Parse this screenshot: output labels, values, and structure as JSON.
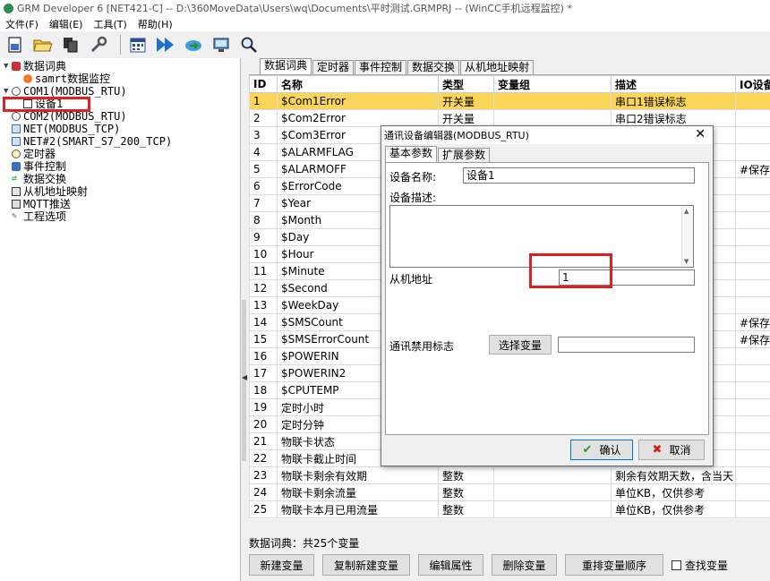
{
  "window": {
    "title": "GRM Developer 6 [NET421-C]  -- D:\\360MoveData\\Users\\wq\\Documents\\平时测试.GRMPRJ -- (WinCC手机远程监控) *"
  },
  "menu": [
    "文件(F)",
    "编辑(E)",
    "工具(T)",
    "帮助(H)"
  ],
  "toolbar_icons": [
    "new-project-icon",
    "open-folder-icon",
    "copy-icon",
    "wrench-icon",
    "calendar-grid-icon",
    "fast-forward-icon",
    "cloud-sync-icon",
    "monitor-icon",
    "search-icon"
  ],
  "tree": {
    "items": [
      {
        "label": "数据词典",
        "icon": "book-icon"
      },
      {
        "label": "samrt数据监控",
        "icon": "tag-icon"
      },
      {
        "label": "COM1(MODBUS_RTU)",
        "icon": "serial-port-icon"
      },
      {
        "label": "设备1",
        "icon": "device-icon"
      },
      {
        "label": "COM2(MODBUS_RTU)",
        "icon": "serial-port-icon"
      },
      {
        "label": "NET(MODBUS_TCP)",
        "icon": "network-icon"
      },
      {
        "label": "NET#2(SMART_S7_200_TCP)",
        "icon": "network-icon"
      },
      {
        "label": "定时器",
        "icon": "clock-icon"
      },
      {
        "label": "事件控制",
        "icon": "event-icon"
      },
      {
        "label": "数据交换",
        "icon": "exchange-icon"
      },
      {
        "label": "从机地址映射",
        "icon": "mapping-icon"
      },
      {
        "label": "MQTT推送",
        "icon": "mqtt-icon"
      },
      {
        "label": "工程选项",
        "icon": "tools-icon"
      }
    ]
  },
  "main_tabs": [
    "数据词典",
    "定时器",
    "事件控制",
    "数据交换",
    "从机地址映射"
  ],
  "grid": {
    "columns": [
      "ID",
      "名称",
      "类型",
      "变量组",
      "描述",
      "IO设备"
    ],
    "rows": [
      [
        "1",
        "$Com1Error",
        "开关量",
        "",
        "串口1错误标志",
        ""
      ],
      [
        "2",
        "$Com2Error",
        "开关量",
        "",
        "串口2错误标志",
        ""
      ],
      [
        "3",
        "$Com3Error",
        "",
        "",
        "",
        ""
      ],
      [
        "4",
        "$ALARMFLAG",
        "",
        "",
        "何报",
        ""
      ],
      [
        "5",
        "$ALARMOFF",
        "",
        "",
        "",
        "#保存位"
      ],
      [
        "6",
        "$ErrorCode",
        "",
        "",
        "",
        ""
      ],
      [
        "7",
        "$Year",
        "",
        "",
        ")",
        ""
      ],
      [
        "8",
        "$Month",
        "",
        "",
        "",
        ""
      ],
      [
        "9",
        "$Day",
        "",
        "",
        "",
        ""
      ],
      [
        "10",
        "$Hour",
        "",
        "",
        "",
        ""
      ],
      [
        "11",
        "$Minute",
        "",
        "",
        "",
        ""
      ],
      [
        "12",
        "$Second",
        "",
        "",
        "",
        ""
      ],
      [
        "13",
        "$WeekDay",
        "",
        "",
        "-，7",
        ""
      ],
      [
        "14",
        "$SMSCount",
        "",
        "",
        "",
        "#保存位"
      ],
      [
        "15",
        "$SMSErrorCount",
        "",
        "",
        "量",
        "#保存位"
      ],
      [
        "16",
        "$POWERIN",
        "",
        "",
        "",
        ""
      ],
      [
        "17",
        "$POWERIN2",
        "",
        "",
        "",
        ""
      ],
      [
        "18",
        "$CPUTEMP",
        "",
        "",
        "05降",
        ""
      ],
      [
        "19",
        "定时小时",
        "",
        "",
        "",
        ""
      ],
      [
        "20",
        "定时分钟",
        "",
        "",
        "",
        ""
      ],
      [
        "21",
        "物联卡状态",
        "",
        "",
        "卡机，",
        ""
      ],
      [
        "22",
        "物联卡截止时间",
        "",
        "",
        "2位月",
        ""
      ],
      [
        "23",
        "物联卡剩余有效期",
        "整数",
        "",
        "剩余有效期天数，含当天",
        ""
      ],
      [
        "24",
        "物联卡剩余流量",
        "整数",
        "",
        "单位KB，仅供参考",
        ""
      ],
      [
        "25",
        "物联卡本月已用流量",
        "整数",
        "",
        "单位KB，仅供参考",
        ""
      ]
    ]
  },
  "status": "数据词典：共25个变量",
  "bottom_buttons": [
    "新建变量",
    "复制新建变量",
    "编辑属性",
    "删除变量",
    "重排变量顺序"
  ],
  "find_checkbox": "查找变量",
  "dialog": {
    "title": "通讯设备编辑器(MODBUS_RTU)",
    "tabs": [
      "基本参数",
      "扩展参数"
    ],
    "device_name_label": "设备名称:",
    "device_name_value": "设备1",
    "device_desc_label": "设备描述:",
    "slave_address_label": "从机地址",
    "slave_address_value": "1",
    "comm_disable_label": "通讯禁用标志",
    "select_var_button": "选择变量",
    "ok_button": "确认",
    "cancel_button": "取消"
  },
  "colors": {
    "selected_row": "#fbd55a",
    "highlight_box": "#e02020"
  }
}
